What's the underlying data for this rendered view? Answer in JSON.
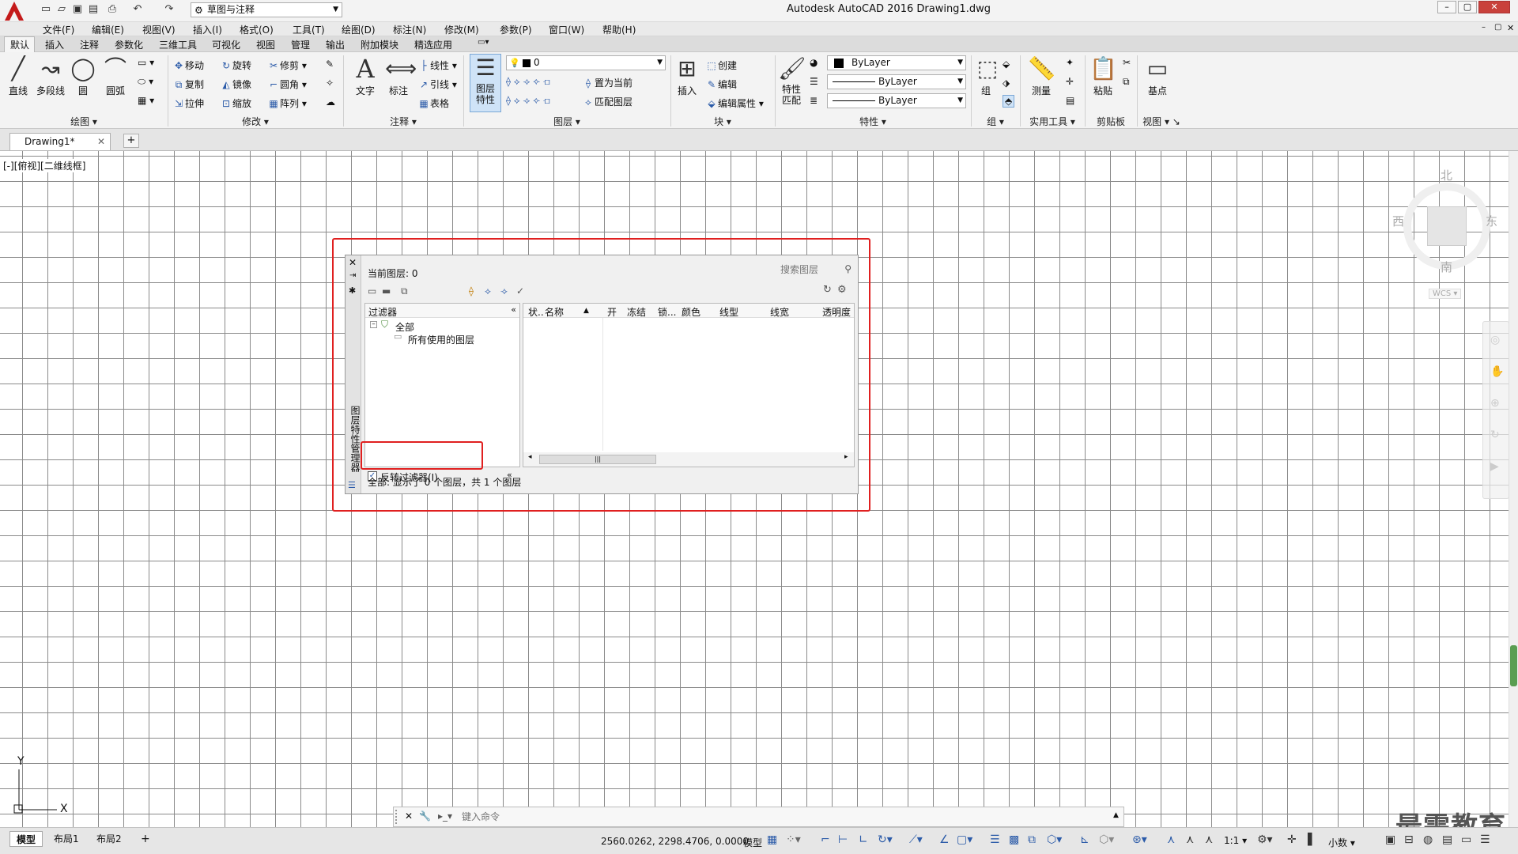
{
  "titlebar": {
    "title": "Autodesk AutoCAD 2016    Drawing1.dwg",
    "workspace": "草图与注释"
  },
  "menubar": [
    "文件(F)",
    "编辑(E)",
    "视图(V)",
    "插入(I)",
    "格式(O)",
    "工具(T)",
    "绘图(D)",
    "标注(N)",
    "修改(M)",
    "参数(P)",
    "窗口(W)",
    "帮助(H)"
  ],
  "ribbon_tabs": [
    "默认",
    "插入",
    "注释",
    "参数化",
    "三维工具",
    "可视化",
    "视图",
    "管理",
    "输出",
    "附加模块",
    "精选应用"
  ],
  "ribbon": {
    "draw": {
      "line": "直线",
      "polyline": "多段线",
      "circle": "圆",
      "arc": "圆弧",
      "panel": "绘图"
    },
    "modify": {
      "move": "移动",
      "rotate": "旋转",
      "trim": "修剪",
      "copy": "复制",
      "mirror": "镜像",
      "fillet": "圆角",
      "stretch": "拉伸",
      "scale": "缩放",
      "array": "阵列",
      "panel": "修改"
    },
    "annotation": {
      "text": "文字",
      "dimension": "标注",
      "linear": "线性",
      "leader": "引线",
      "table": "表格",
      "panel": "注释"
    },
    "layers": {
      "props": "图层\n特性",
      "current_layer": "0",
      "make_current": "置为当前",
      "match": "匹配图层",
      "panel": "图层"
    },
    "block": {
      "insert": "插入",
      "create": "创建",
      "edit": "编辑",
      "edit_attr": "编辑属性",
      "panel": "块"
    },
    "properties": {
      "match": "特性\n匹配",
      "color": "ByLayer",
      "linetype": "ByLayer",
      "lineweight": "ByLayer",
      "panel": "特性"
    },
    "group": {
      "group": "组",
      "panel": "组"
    },
    "utilities": {
      "measure": "测量",
      "panel": "实用工具"
    },
    "clipboard": {
      "paste": "粘贴",
      "panel": "剪贴板"
    },
    "view": {
      "base": "基点",
      "panel": "视图"
    }
  },
  "doc_tab": "Drawing1*",
  "viewport_label": "[-][俯视][二维线框]",
  "viewcube": {
    "north": "北",
    "south": "南",
    "east": "东",
    "west": "西",
    "wcs": "WCS"
  },
  "ucs": {
    "x": "X",
    "y": "Y"
  },
  "layer_panel": {
    "current_layer": "当前图层: 0",
    "search_placeholder": "搜索图层",
    "filters_header": "过滤器",
    "tree_all": "全部",
    "tree_used": "所有使用的图层",
    "columns": [
      "状..",
      "名称",
      "开",
      "冻结",
      "锁...",
      "颜色",
      "线型",
      "线宽",
      "透明度"
    ],
    "invert_filter": "反转过滤器(I)",
    "status": "全部: 显示了 0 个图层，共 1 个图层",
    "vertical_title": "图层特性管理器"
  },
  "cmdline": {
    "placeholder": "键入命令"
  },
  "statusbar": {
    "tabs": [
      "模型",
      "布局1",
      "布局2"
    ],
    "coords": "2560.0262, 2298.4706, 0.0000",
    "mode": "模型",
    "scale": "1:1",
    "units": "小数"
  },
  "watermark": "最需教育"
}
